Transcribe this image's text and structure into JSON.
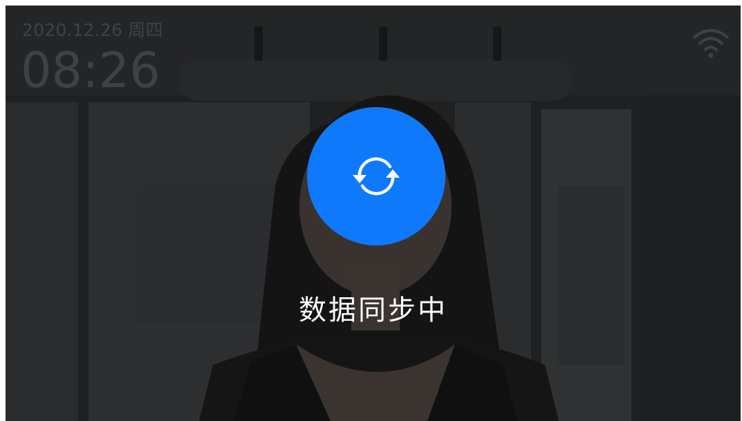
{
  "status_bar": {
    "date": "2020.12.26 周四",
    "time": "08:26",
    "wifi_icon": "wifi-icon"
  },
  "sync": {
    "icon": "sync-icon",
    "color": "#0f79fc",
    "message": "数据同步中"
  }
}
